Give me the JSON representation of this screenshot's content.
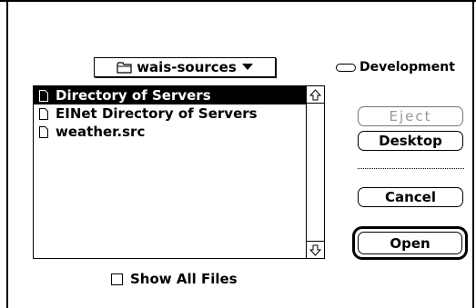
{
  "dialog": {
    "folder_popup": {
      "label": "wais-sources",
      "icon": "folder-icon"
    },
    "drive": {
      "label": "Development",
      "icon": "drive-icon"
    },
    "files": [
      {
        "name": "Directory of Servers",
        "selected": true,
        "icon": "document-icon"
      },
      {
        "name": "EINet Directory of Servers",
        "selected": false,
        "icon": "document-icon"
      },
      {
        "name": "weather.src",
        "selected": false,
        "icon": "document-icon"
      }
    ],
    "buttons": {
      "eject": "Eject",
      "desktop": "Desktop",
      "cancel": "Cancel",
      "open": "Open"
    },
    "show_all_files": {
      "label": "Show All Files",
      "checked": false
    }
  }
}
